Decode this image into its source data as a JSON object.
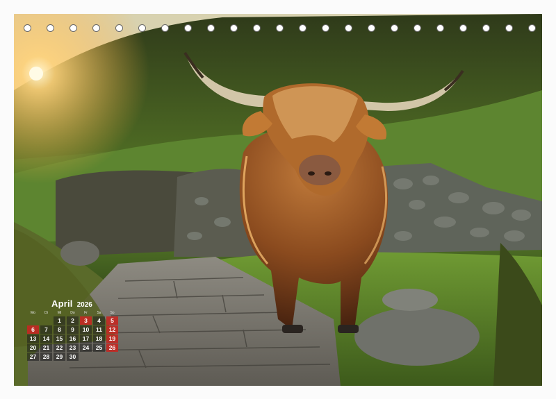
{
  "calendar": {
    "month": "April",
    "year": "2026",
    "weekdays": [
      "Mo",
      "Di",
      "Mi",
      "Do",
      "Fr",
      "Sa",
      "So"
    ],
    "weeks": [
      [
        "",
        "",
        "1",
        "2",
        "3",
        "4",
        "5"
      ],
      [
        "6",
        "7",
        "8",
        "9",
        "10",
        "11",
        "12"
      ],
      [
        "13",
        "14",
        "15",
        "16",
        "17",
        "18",
        "19"
      ],
      [
        "20",
        "21",
        "22",
        "23",
        "24",
        "25",
        "26"
      ],
      [
        "27",
        "28",
        "29",
        "30",
        "",
        "",
        ""
      ]
    ],
    "highlighted_days": [
      "3",
      "5",
      "6",
      "12",
      "19",
      "26"
    ],
    "highlight_color": "#c42822"
  },
  "binding_holes": {
    "count": 23
  },
  "photo": {
    "subject": "highland-cow-icon"
  }
}
